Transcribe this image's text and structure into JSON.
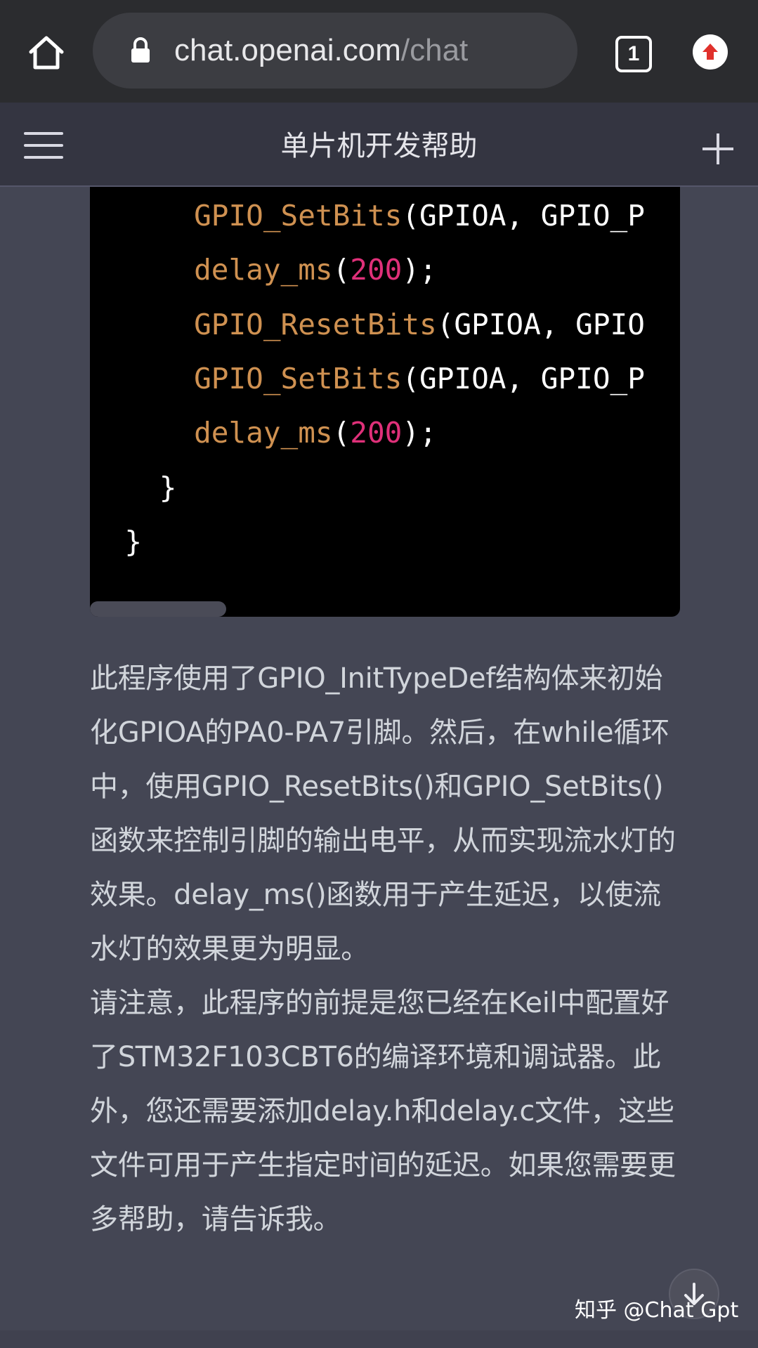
{
  "browser": {
    "url_host": "chat.openai.com",
    "url_path": "/chat",
    "tab_count": "1"
  },
  "header": {
    "title": "单片机开发帮助"
  },
  "code": {
    "lines": [
      {
        "indent": "      ",
        "fn": "GPIO_SetBits",
        "rest": "(GPIOA, GPIO_P"
      },
      {
        "indent": "      ",
        "fn": "delay_ms",
        "open": "(",
        "num": "200",
        "close": ");"
      },
      {
        "indent": "      ",
        "fn": "GPIO_ResetBits",
        "rest": "(GPIOA, GPIO"
      },
      {
        "indent": "      ",
        "fn": "GPIO_SetBits",
        "rest": "(GPIOA, GPIO_P"
      },
      {
        "indent": "      ",
        "fn": "delay_ms",
        "open": "(",
        "num": "200",
        "close": ");"
      },
      {
        "indent": "    ",
        "text": "}"
      },
      {
        "indent": "  ",
        "text": "}"
      }
    ]
  },
  "answer": {
    "paragraph1": "此程序使用了GPIO_InitTypeDef结构体来初始化GPIOA的PA0-PA7引脚。然后，在while循环中，使用GPIO_ResetBits()和GPIO_SetBits()函数来控制引脚的输出电平，从而实现流水灯的效果。delay_ms()函数用于产生延迟，以使流水灯的效果更为明显。",
    "paragraph2": "请注意，此程序的前提是您已经在Keil中配置好了STM32F103CBT6的编译环境和调试器。此外，您还需要添加delay.h和delay.c文件，这些文件可用于产生指定时间的延迟。如果您需要更多帮助，请告诉我。"
  },
  "watermark": "知乎 @Chat Gpt",
  "colors": {
    "background": "#444654",
    "code_bg": "#000000",
    "function": "#e6a15a",
    "number": "#df3079",
    "text": "#d1d5db"
  }
}
